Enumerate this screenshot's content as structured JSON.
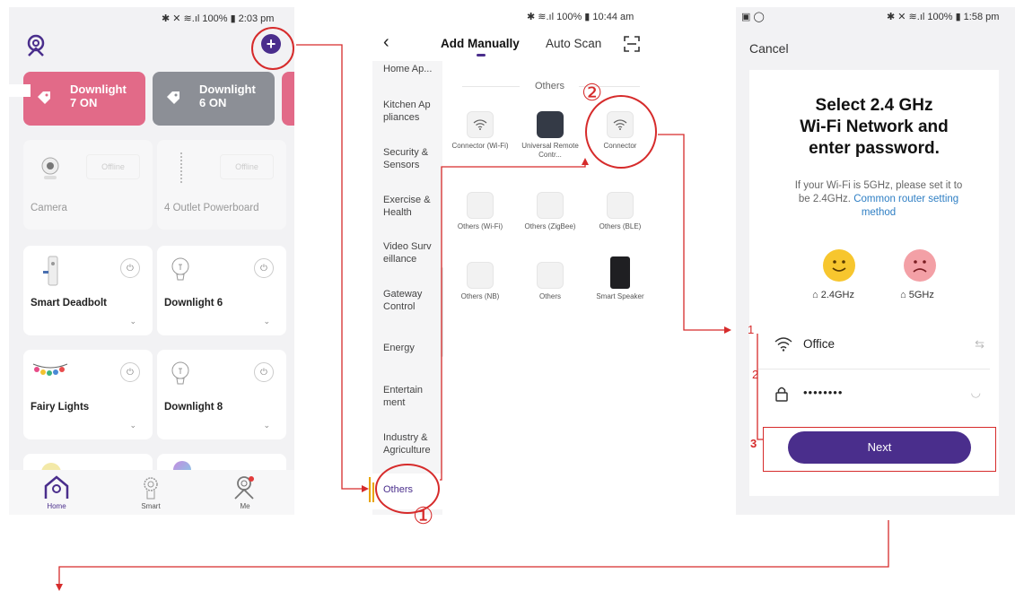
{
  "phone1": {
    "status": "100% ▮ 2:03 pm",
    "scenes": [
      {
        "line1": "Downlight",
        "line2": "7 ON",
        "color": "#e26a88"
      },
      {
        "line1": "Downlight",
        "line2": "6 ON",
        "color": "#8c8f96"
      }
    ],
    "devices": [
      {
        "name": "Camera",
        "status": "Offline"
      },
      {
        "name": "4 Outlet Powerboard",
        "status": "Offline"
      },
      {
        "name": "Smart Deadbolt"
      },
      {
        "name": "Downlight 6"
      },
      {
        "name": "Fairy Lights"
      },
      {
        "name": "Downlight 8"
      }
    ],
    "tabs": [
      "Home",
      "Smart",
      "Me"
    ],
    "accent": "#4a2e8c"
  },
  "phone2": {
    "status": "100% ▮ 10:44 am",
    "tabs": {
      "active": "Add Manually",
      "other": "Auto Scan"
    },
    "categories": [
      "Home Ap...",
      "Kitchen Ap pliances",
      "Security & Sensors",
      "Exercise & Health",
      "Video Surv eillance",
      "Gateway Control",
      "Energy",
      "Entertain ment",
      "Industry & Agriculture",
      "Others"
    ],
    "section_title": "Others",
    "devices": [
      {
        "label": "Connector (Wi-Fi)"
      },
      {
        "label": "Universal Remote Contr..."
      },
      {
        "label": "Connector"
      },
      {
        "label": "Others (Wi-Fi)"
      },
      {
        "label": "Others (ZigBee)"
      },
      {
        "label": "Others (BLE)"
      },
      {
        "label": "Others (NB)"
      },
      {
        "label": "Others"
      },
      {
        "label": "Smart Speaker"
      }
    ]
  },
  "phone3": {
    "status": "100% ▮ 1:58 pm",
    "cancel": "Cancel",
    "title_l1": "Select 2.4 GHz",
    "title_l2": "Wi-Fi Network and",
    "title_l3": "enter password.",
    "hint": "If your Wi-Fi is 5GHz, please set it to be 2.4GHz.",
    "hint_link": "Common router setting method",
    "band_ok": "2.4GHz",
    "band_bad": "5GHz",
    "ssid": "Office",
    "password": "••••••••",
    "next": "Next",
    "link_color": "#2f7fc4"
  },
  "annotations": {
    "n1": "①",
    "n2": "②",
    "s1": "1",
    "s2": "2",
    "s3": "3"
  }
}
